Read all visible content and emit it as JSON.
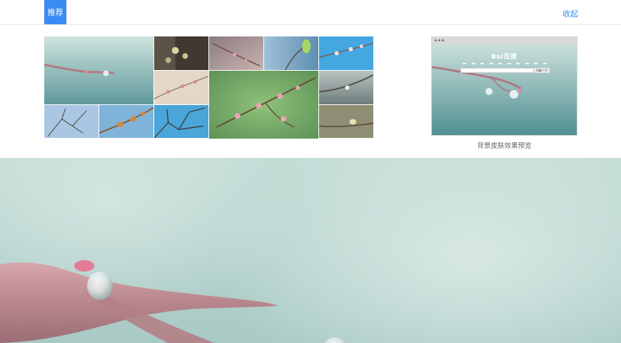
{
  "tabs": {
    "active_label": "推荐",
    "collapse_label": "收起"
  },
  "gallery": {
    "thumbnails": [
      {
        "name": "raindrop-branch-teal"
      },
      {
        "name": "buds-dark-bark"
      },
      {
        "name": "twig-pink-dusk"
      },
      {
        "name": "green-leaf-bud-blue"
      },
      {
        "name": "blossom-blue-sky"
      },
      {
        "name": "pink-buds-cream"
      },
      {
        "name": "pink-buds-green-large"
      },
      {
        "name": "raindrop-grey-branch"
      },
      {
        "name": "bare-twigs-blue"
      },
      {
        "name": "orange-buds-sky"
      },
      {
        "name": "branches-blue-sky"
      },
      {
        "name": "bird-on-branch"
      }
    ]
  },
  "preview": {
    "logo_text": "Bai百度",
    "search_button": "百度一下",
    "caption": "背景皮肤效果预览"
  },
  "colors": {
    "accent": "#3a8cf4",
    "background_teal": "#bcd6d0"
  }
}
